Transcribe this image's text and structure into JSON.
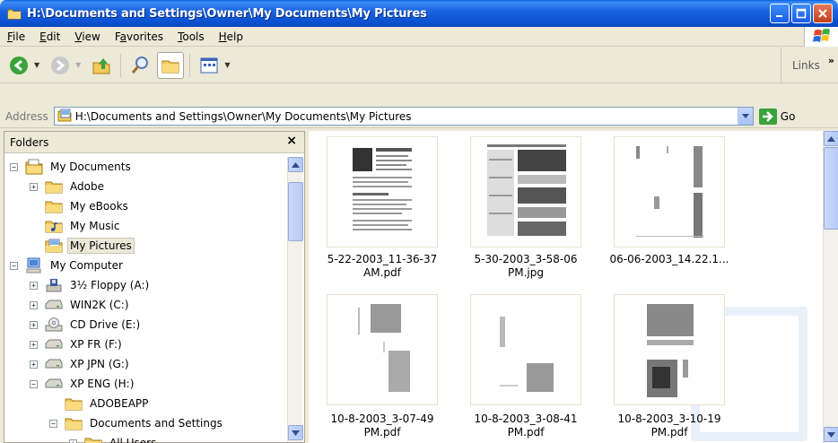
{
  "window": {
    "title": "H:\\Documents and Settings\\Owner\\My Documents\\My Pictures"
  },
  "menu": [
    "File",
    "Edit",
    "View",
    "Favorites",
    "Tools",
    "Help"
  ],
  "menu_accel": [
    "F",
    "E",
    "V",
    "a",
    "T",
    "H"
  ],
  "toolbar": {
    "links_label": "Links",
    "chevron": "»",
    "icons": [
      "back-arrow-icon",
      "forward-arrow-icon",
      "up-folder-icon",
      "search-icon",
      "folders-icon",
      "views-icon"
    ]
  },
  "address": {
    "label": "Address",
    "value": "H:\\Documents and Settings\\Owner\\My Documents\\My Pictures",
    "go_label": "Go"
  },
  "folders": {
    "title": "Folders",
    "close": "×",
    "tree": [
      {
        "label": "My Documents",
        "expander": "−",
        "icon": "my-documents-icon"
      },
      {
        "label": "Adobe",
        "expander": "+",
        "icon": "folder-icon"
      },
      {
        "label": "My eBooks",
        "expander": "",
        "icon": "folder-icon"
      },
      {
        "label": "My Music",
        "expander": "",
        "icon": "music-folder-icon"
      },
      {
        "label": "My Pictures",
        "expander": "",
        "icon": "pictures-folder-icon",
        "selected": true
      },
      {
        "label": "My Computer",
        "expander": "−",
        "icon": "computer-icon"
      },
      {
        "label": "3½ Floppy (A:)",
        "expander": "+",
        "icon": "floppy-icon"
      },
      {
        "label": "WIN2K (C:)",
        "expander": "+",
        "icon": "drive-icon"
      },
      {
        "label": "CD Drive (E:)",
        "expander": "+",
        "icon": "cd-drive-icon"
      },
      {
        "label": "XP FR (F:)",
        "expander": "+",
        "icon": "drive-icon"
      },
      {
        "label": "XP JPN (G:)",
        "expander": "+",
        "icon": "drive-icon"
      },
      {
        "label": "XP ENG (H:)",
        "expander": "−",
        "icon": "drive-icon"
      },
      {
        "label": "ADOBEAPP",
        "expander": "",
        "icon": "folder-icon"
      },
      {
        "label": "Documents and Settings",
        "expander": "−",
        "icon": "folder-icon"
      },
      {
        "label": "All Users",
        "expander": "+",
        "icon": "folder-icon"
      }
    ]
  },
  "files": [
    {
      "name_line1": "5-22-2003_11-36-37",
      "name_line2": "AM.pdf"
    },
    {
      "name_line1": "5-30-2003_3-58-06",
      "name_line2": "PM.jpg"
    },
    {
      "name_line1": "06-06-2003_14.22.1...",
      "name_line2": ""
    },
    {
      "name_line1": "10-8-2003_3-07-49",
      "name_line2": "PM.pdf"
    },
    {
      "name_line1": "10-8-2003_3-08-41",
      "name_line2": "PM.pdf"
    },
    {
      "name_line1": "10-8-2003_3-10-19",
      "name_line2": "PM.pdf"
    }
  ],
  "colors": {
    "titlebar": "#0a50d0",
    "chrome": "#ece9d8",
    "scrollbar": "#b3c8f4"
  }
}
